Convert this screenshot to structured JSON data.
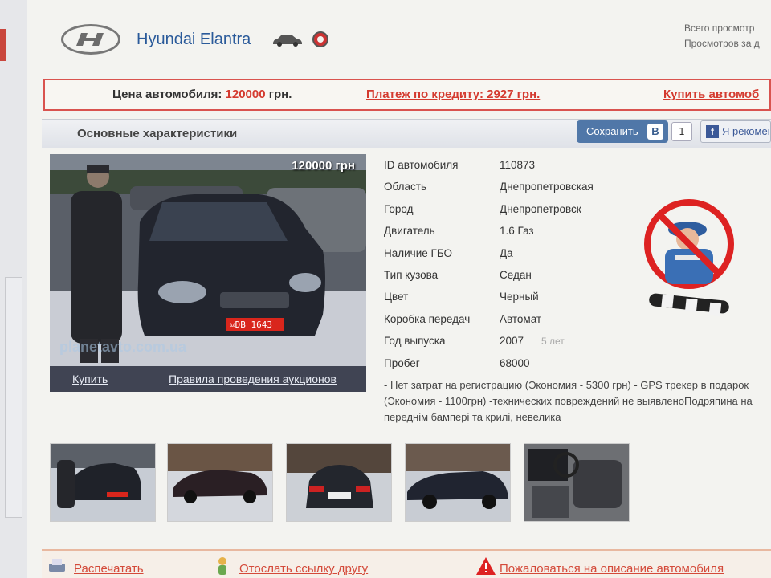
{
  "header": {
    "title": "Hyundai Elantra",
    "brand_icon": "hyundai-logo",
    "views_total": "Всего просмотр",
    "views_today": "Просмотров за д"
  },
  "price_bar": {
    "price_label": "Цена автомобиля:",
    "price_value": "120000",
    "price_currency": "грн.",
    "credit_text": "Платеж по кредиту: 2927 грн.",
    "buy_text": "Купить автомоб"
  },
  "section": {
    "title": "Основные характеристики",
    "save_label": "Сохранить",
    "vk_label": "В",
    "share_count": "1",
    "fb_label": "Я рекомен"
  },
  "photo": {
    "price": "120000 грн",
    "watermark": "planetavto.com.ua",
    "plate": "¤DB 1643",
    "buy_link": "Купить",
    "rules_link": "Правила проведения аукционов"
  },
  "specs": [
    {
      "key": "ID автомобиля",
      "value": "110873"
    },
    {
      "key": "Область",
      "value": "Днепропетровская"
    },
    {
      "key": "Город",
      "value": "Днепропетровск"
    },
    {
      "key": "Двигатель",
      "value": "1.6 Газ"
    },
    {
      "key": "Наличие ГБО",
      "value": "Да"
    },
    {
      "key": "Тип кузова",
      "value": "Седан"
    },
    {
      "key": "Цвет",
      "value": "Черный"
    },
    {
      "key": "Коробка передач",
      "value": "Автомат"
    },
    {
      "key": "Год выпуска",
      "value": "2007",
      "sub": "5 лет"
    },
    {
      "key": "Пробег",
      "value": "68000"
    }
  ],
  "description": "- Нет затрат на регистрацию (Экономия - 5300 грн) - GPS трекер в подарок (Экономия - 1100грн) -технических повреждений не выявленоПодряпина на переднім бампері та крилі, невелика",
  "footer": {
    "print": "Распечатать",
    "send": "Отослать ссылку другу",
    "complain": "Пожаловаться на описание автомобиля"
  },
  "colors": {
    "accent_red": "#d43a2f",
    "title_blue": "#2a5a9a",
    "save_button": "#5077a8"
  }
}
